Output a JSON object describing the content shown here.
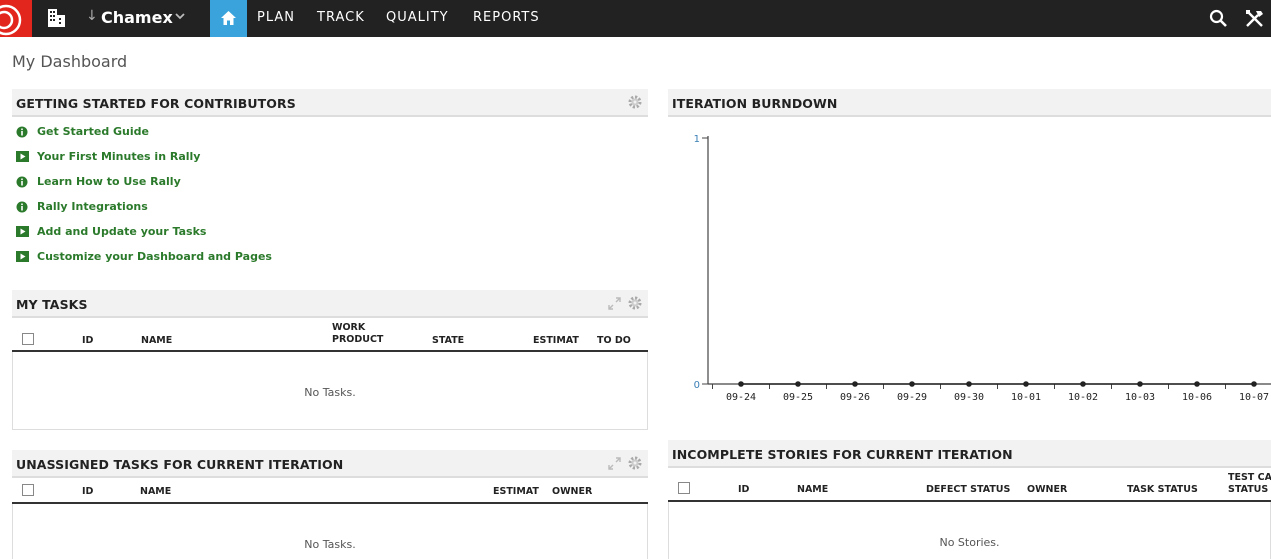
{
  "topbar": {
    "workspace_name": "Chamex",
    "nav": [
      "PLAN",
      "TRACK",
      "QUALITY",
      "REPORTS"
    ]
  },
  "page": {
    "title": "My Dashboard"
  },
  "getting_started": {
    "title": "GETTING STARTED FOR CONTRIBUTORS",
    "links": [
      {
        "label": "Get Started Guide",
        "icon": "info-icon"
      },
      {
        "label": "Your First Minutes in Rally",
        "icon": "video-icon"
      },
      {
        "label": "Learn How to Use Rally",
        "icon": "info-icon"
      },
      {
        "label": "Rally Integrations",
        "icon": "info-icon"
      },
      {
        "label": "Add and Update your Tasks",
        "icon": "video-icon"
      },
      {
        "label": "Customize your Dashboard and Pages",
        "icon": "video-icon"
      }
    ]
  },
  "my_tasks": {
    "title": "MY TASKS",
    "columns": {
      "id": "ID",
      "name": "NAME",
      "work_product_1": "WORK",
      "work_product_2": "PRODUCT",
      "state": "STATE",
      "estimate": "ESTIMAT",
      "todo": "TO DO"
    },
    "empty": "No Tasks."
  },
  "unassigned_tasks": {
    "title": "UNASSIGNED TASKS FOR CURRENT ITERATION",
    "columns": {
      "id": "ID",
      "name": "NAME",
      "estimate": "ESTIMAT",
      "owner": "OWNER"
    },
    "empty": "No Tasks."
  },
  "burndown": {
    "title": "ITERATION BURNDOWN"
  },
  "incomplete_stories": {
    "title": "INCOMPLETE STORIES FOR CURRENT ITERATION",
    "columns": {
      "id": "ID",
      "name": "NAME",
      "defect_status": "DEFECT STATUS",
      "owner": "OWNER",
      "task_status": "TASK STATUS",
      "test_case_1": "TEST CAS",
      "test_case_2": "STATUS"
    },
    "empty": "No Stories."
  },
  "colors": {
    "accent": "#3aa3dc",
    "link": "#2b7a2b",
    "brand": "#e3261d"
  },
  "chart_data": {
    "type": "line",
    "title": "",
    "xlabel": "",
    "ylabel": "",
    "categories": [
      "09-24",
      "09-25",
      "09-26",
      "09-29",
      "09-30",
      "10-01",
      "10-02",
      "10-03",
      "10-06",
      "10-07"
    ],
    "series": [
      {
        "values": [
          0,
          0,
          0,
          0,
          0,
          0,
          0,
          0,
          0,
          0
        ]
      }
    ],
    "ylim": [
      0,
      1
    ],
    "yticks": [
      "0",
      "1"
    ],
    "grid": false
  }
}
